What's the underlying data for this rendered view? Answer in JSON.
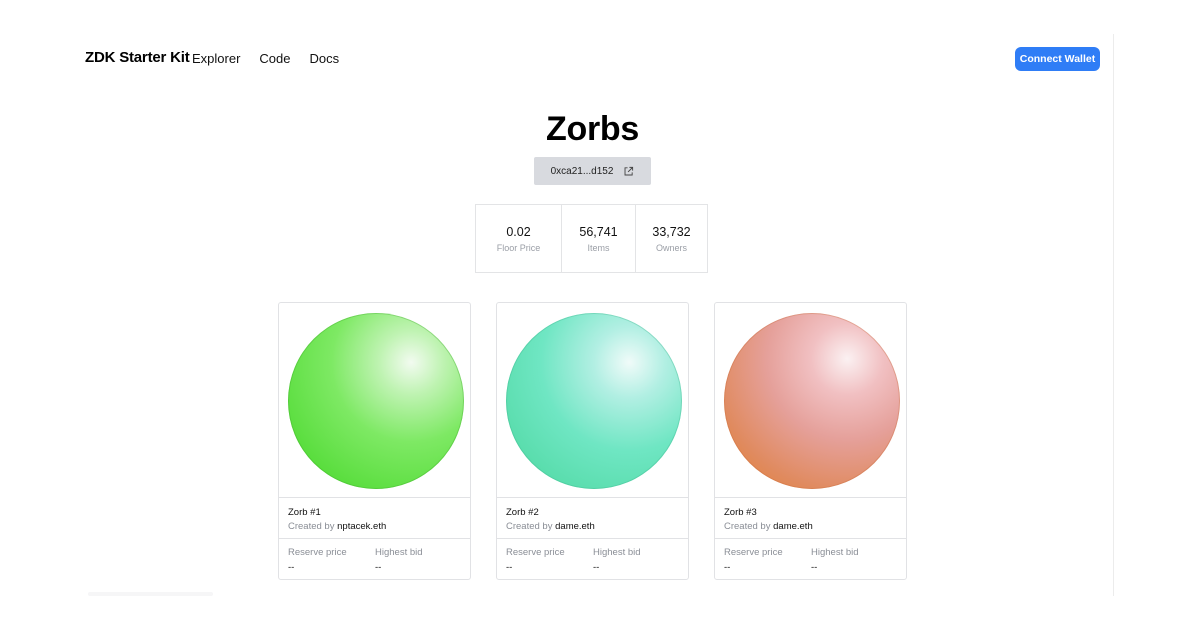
{
  "header": {
    "brand": "ZDK Starter Kit",
    "nav": [
      "Explorer",
      "Code",
      "Docs"
    ],
    "connect_label": "Connect Wallet"
  },
  "collection": {
    "title": "Zorbs",
    "address": "0xca21...d152",
    "stats": [
      {
        "value": "0.02",
        "label": "Floor Price"
      },
      {
        "value": "56,741",
        "label": "Items"
      },
      {
        "value": "33,732",
        "label": "Owners"
      }
    ]
  },
  "cards": [
    {
      "name": "Zorb #1",
      "created_prefix": "Created by",
      "creator": "nptacek.eth",
      "reserve_label": "Reserve price",
      "reserve_value": "--",
      "bid_label": "Highest bid",
      "bid_value": "--"
    },
    {
      "name": "Zorb #2",
      "created_prefix": "Created by",
      "creator": "dame.eth",
      "reserve_label": "Reserve price",
      "reserve_value": "--",
      "bid_label": "Highest bid",
      "bid_value": "--"
    },
    {
      "name": "Zorb #3",
      "created_prefix": "Created by",
      "creator": "dame.eth",
      "reserve_label": "Reserve price",
      "reserve_value": "--",
      "bid_label": "Highest bid",
      "bid_value": "--"
    }
  ],
  "icons": {
    "address_action": "external-link-icon"
  },
  "colors": {
    "accent": "#2f7df6",
    "chip_background": "#d8dadf"
  }
}
